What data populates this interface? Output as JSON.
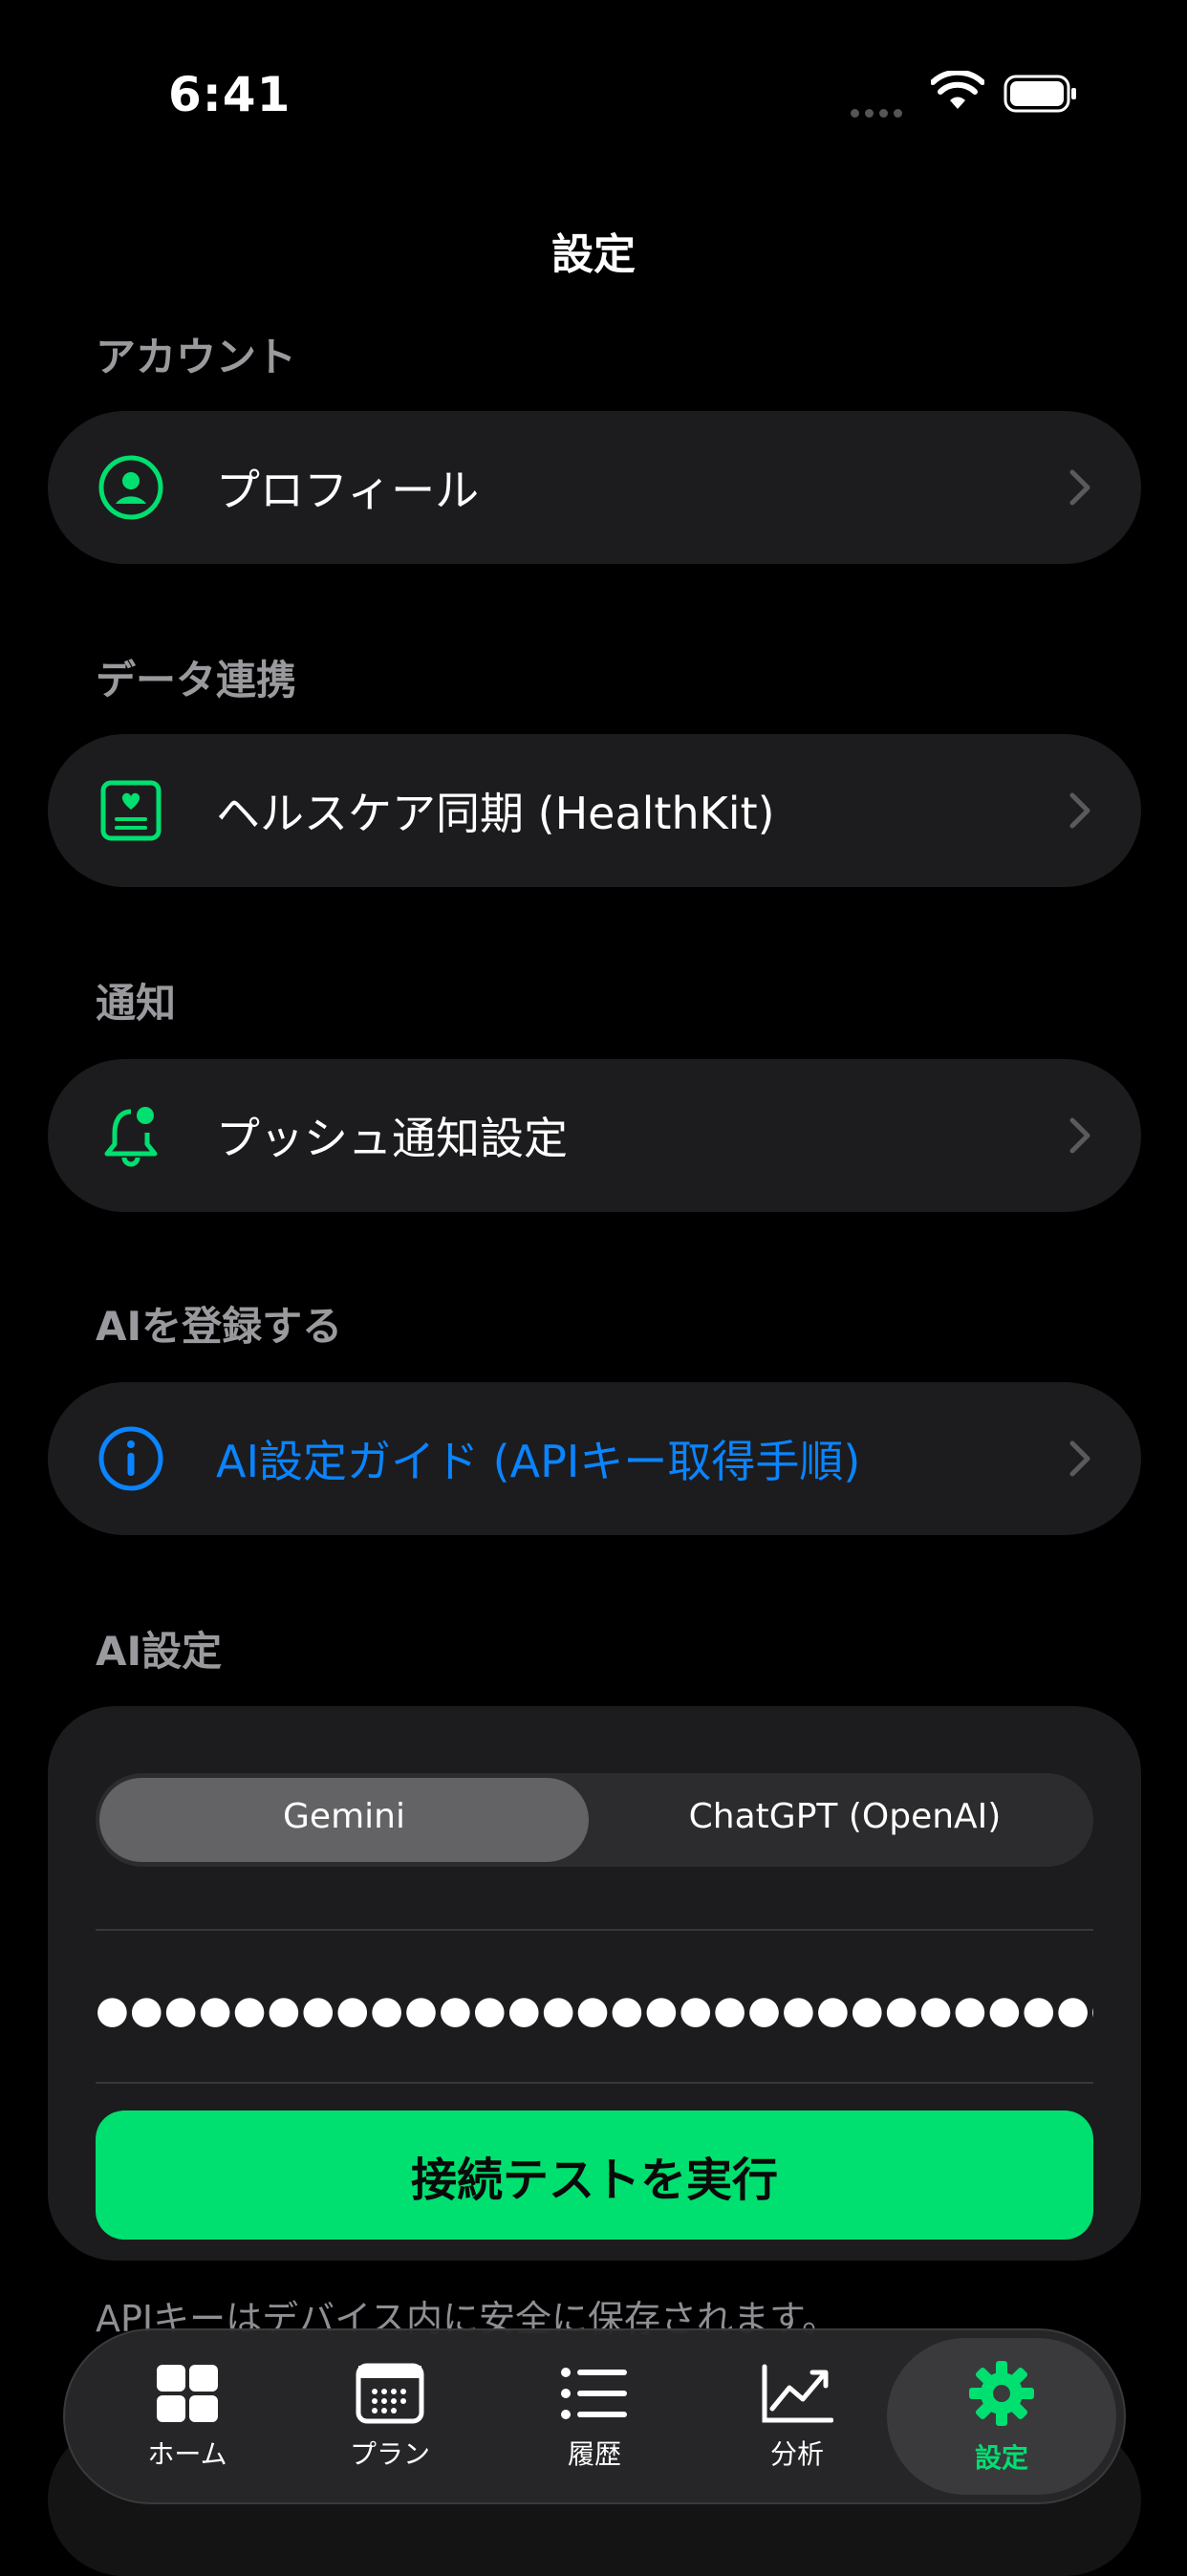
{
  "status_bar": {
    "time": "6:41"
  },
  "nav": {
    "title": "設定"
  },
  "sections": {
    "account": {
      "header": "アカウント",
      "row_label": "プロフィール"
    },
    "data_link": {
      "header": "データ連携",
      "row_label": "ヘルスケア同期 (HealthKit)"
    },
    "notifications": {
      "header": "通知",
      "row_label": "プッシュ通知設定"
    },
    "register_ai": {
      "header": "AIを登録する",
      "row_label": "AI設定ガイド (APIキー取得手順)"
    },
    "ai_settings": {
      "header": "AI設定",
      "providers": [
        "Gemini",
        "ChatGPT (OpenAI)"
      ],
      "selected_provider": "Gemini",
      "api_key_masked": "●●●●●●●●●●●●●●●●●●●●●●●●●●●●●●●●...",
      "test_button": "接続テストを実行",
      "footnote": "APIキーはデバイス内に安全に保存されます。"
    }
  },
  "tab_bar": {
    "items": [
      {
        "label": "ホーム",
        "icon": "grid-icon"
      },
      {
        "label": "プラン",
        "icon": "calendar-icon"
      },
      {
        "label": "履歴",
        "icon": "list-icon"
      },
      {
        "label": "分析",
        "icon": "chart-icon"
      },
      {
        "label": "設定",
        "icon": "gear-icon"
      }
    ],
    "selected": "設定"
  },
  "colors": {
    "accent_green": "#00e070",
    "link_blue": "#0a84ff",
    "card_bg": "#1c1c1e"
  }
}
